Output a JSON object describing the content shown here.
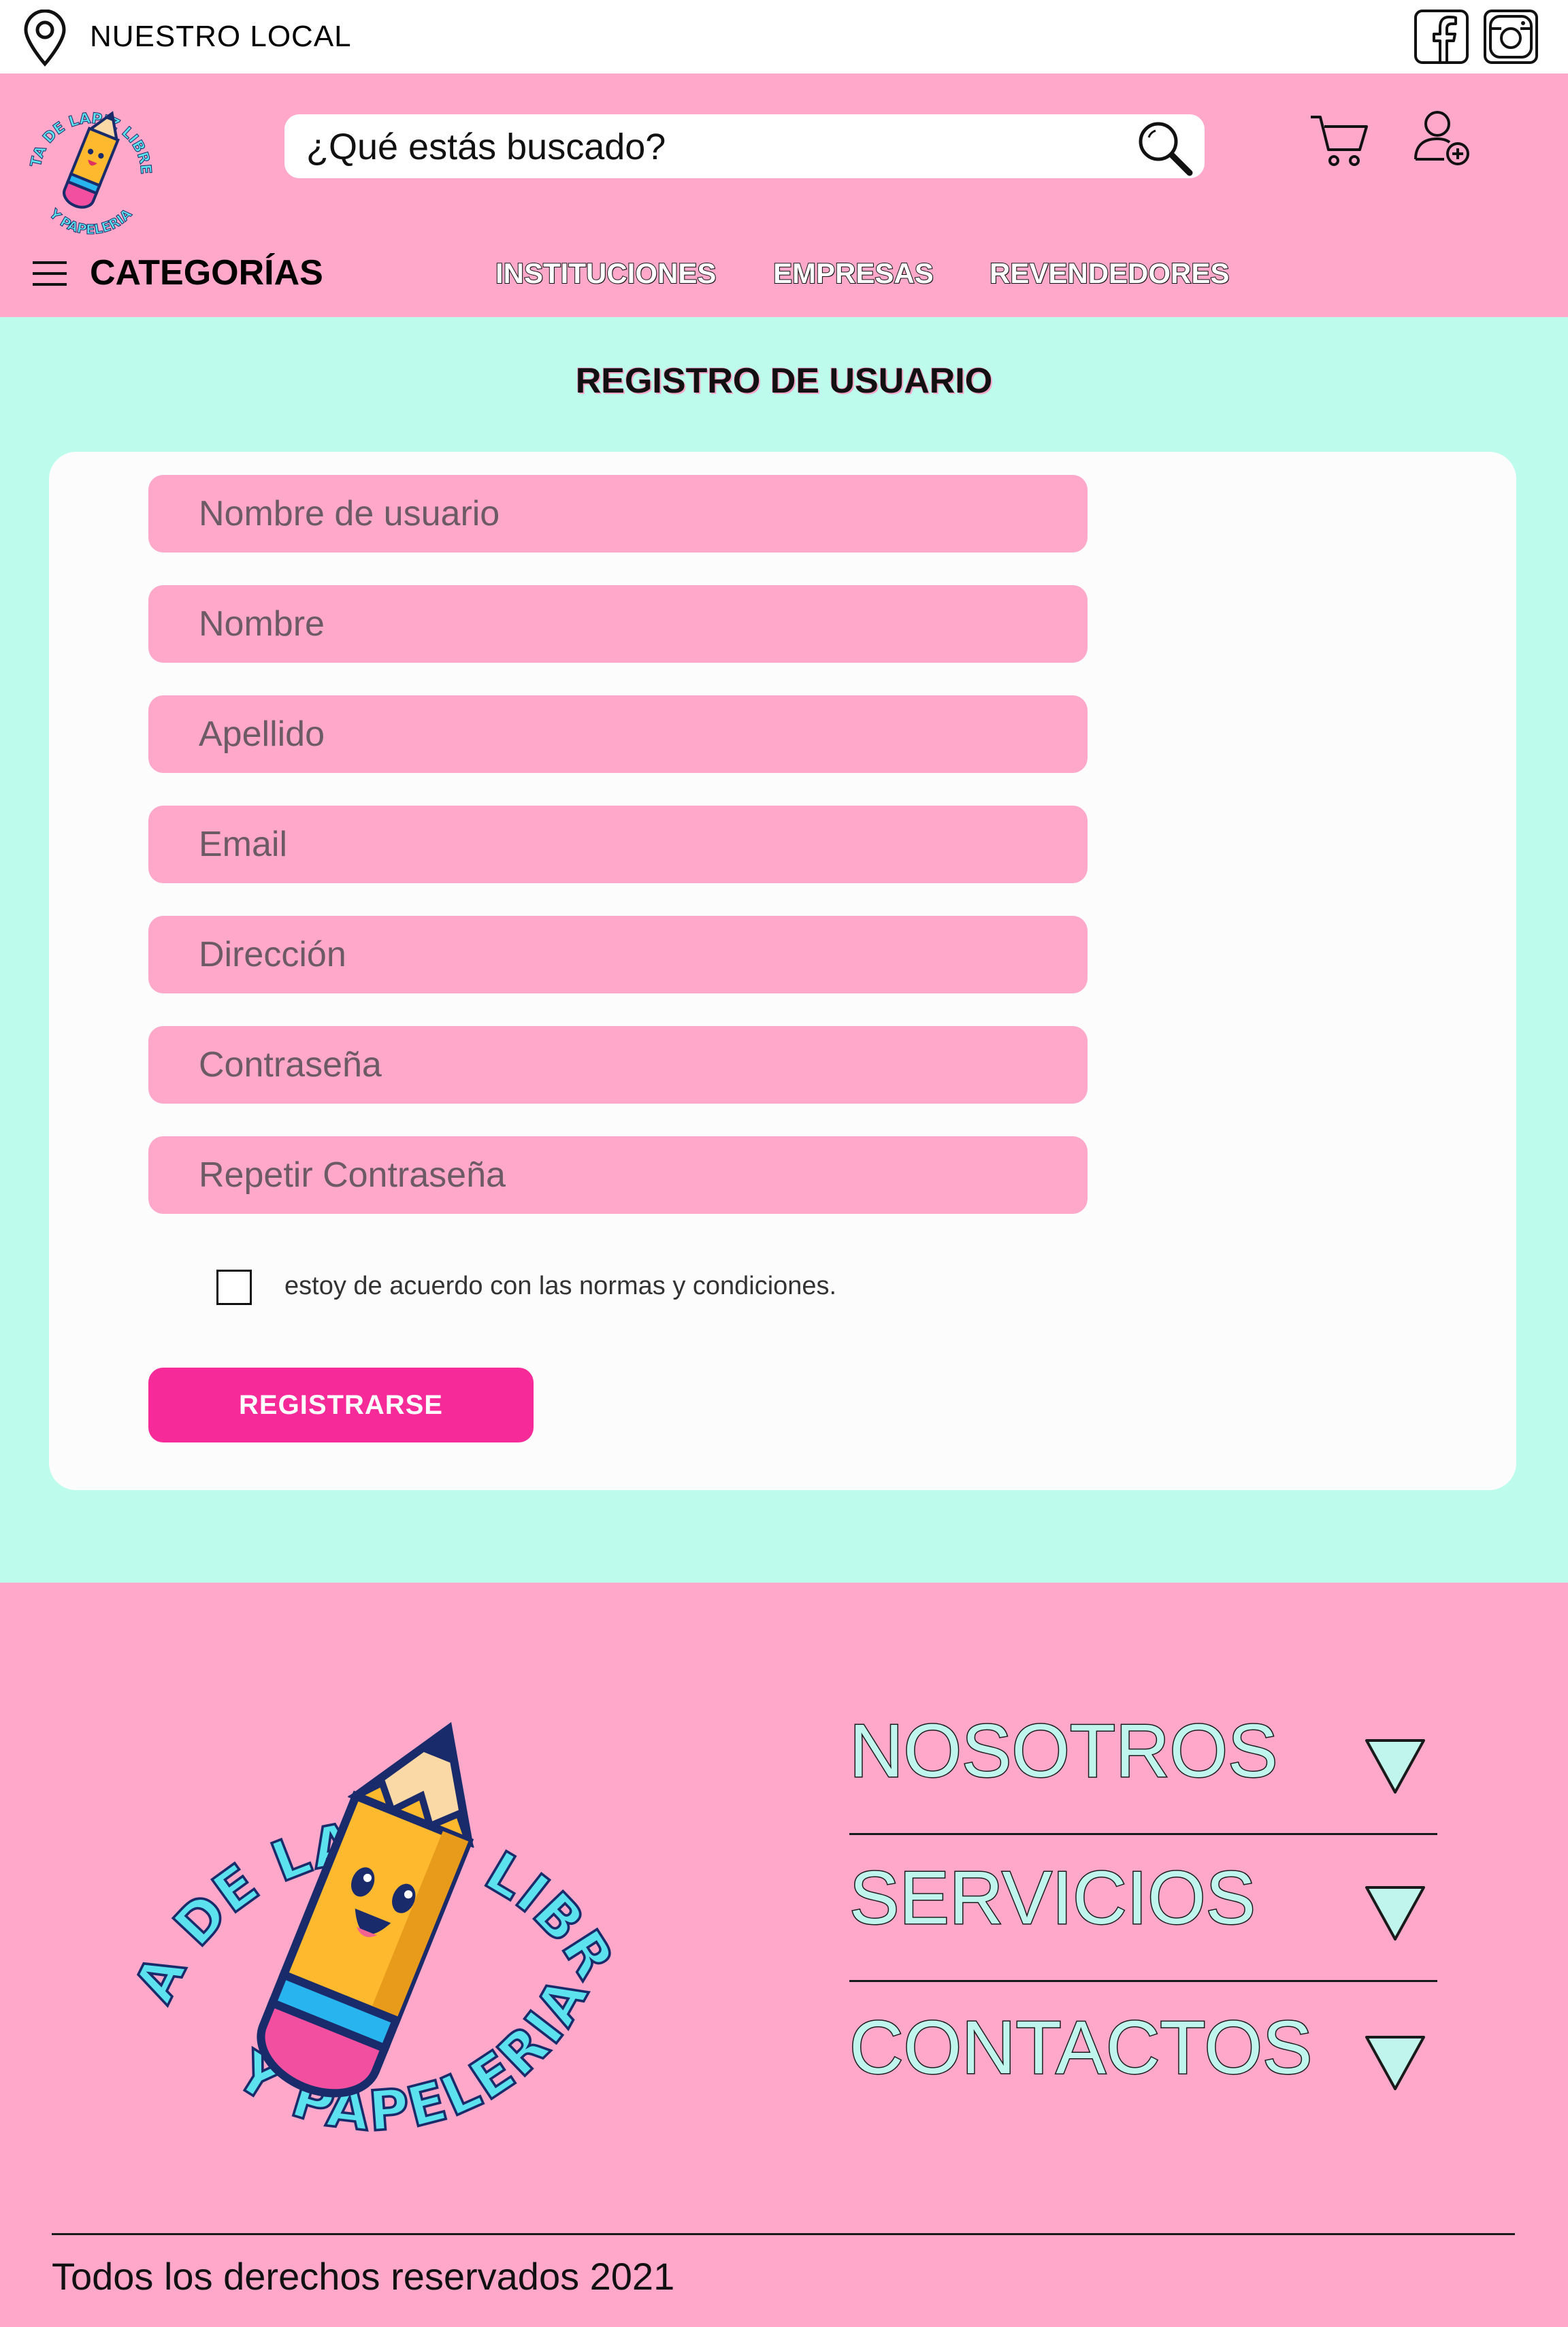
{
  "colors": {
    "pink": "#ffa8c9",
    "mint": "#bdfcec",
    "accent": "#f72a9a",
    "cyan": "#5ce2ee"
  },
  "topbar": {
    "location_label": "NUESTRO LOCAL",
    "icons": [
      "location-pin-icon",
      "facebook-icon",
      "instagram-icon"
    ]
  },
  "header": {
    "logo_text_top": "PUNTA DE LAPIZ",
    "logo_text_bottom": "LIBRERIA Y PAPELERIA",
    "search": {
      "value": "¿Qué estás buscado?"
    },
    "icons": [
      "search-icon",
      "cart-icon",
      "add-user-icon",
      "menu-icon"
    ]
  },
  "nav": {
    "categories_label": "CATEGORÍAS",
    "links": [
      "INSTITUCIONES",
      "EMPRESAS",
      "REVENDEDORES"
    ]
  },
  "registration": {
    "title": "REGISTRO DE USUARIO",
    "fields": [
      {
        "placeholder": "Nombre de usuario"
      },
      {
        "placeholder": "Nombre"
      },
      {
        "placeholder": "Apellido"
      },
      {
        "placeholder": "Email"
      },
      {
        "placeholder": "Dirección"
      },
      {
        "placeholder": "Contraseña"
      },
      {
        "placeholder": "Repetir Contraseña"
      }
    ],
    "terms_label": "estoy de acuerdo con las normas y condiciones.",
    "terms_checked": false,
    "submit_label": "REGISTRARSE"
  },
  "footer": {
    "sections": [
      "NOSOTROS",
      "SERVICIOS",
      "CONTACTOS"
    ],
    "copyright": "Todos los derechos reservados 2021"
  }
}
